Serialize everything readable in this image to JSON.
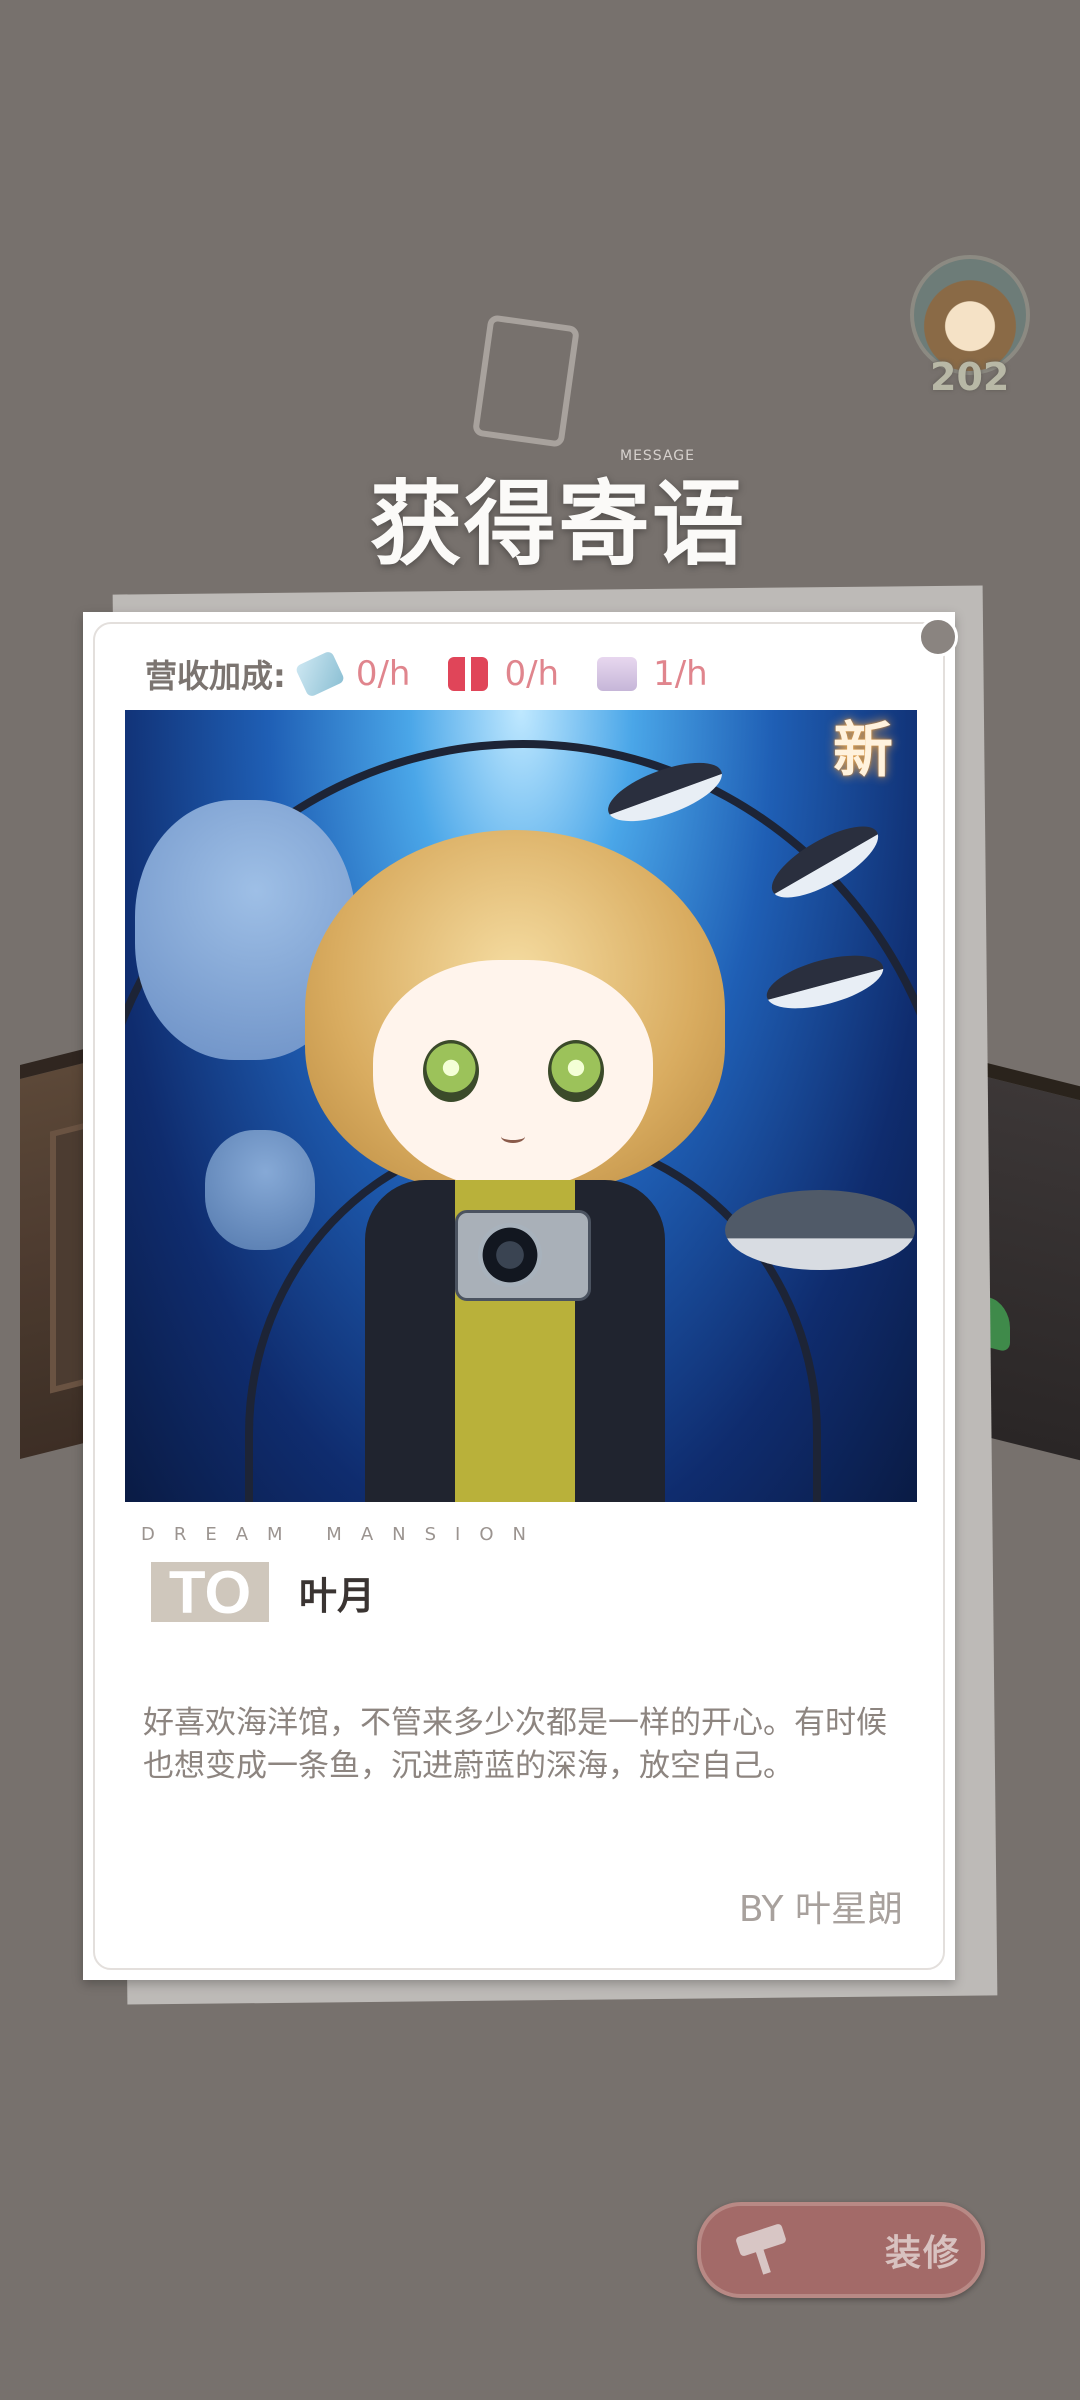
{
  "popup": {
    "title": "获得寄语",
    "title_sub": "MESSAGE",
    "new_tag": "新"
  },
  "player": {
    "level": "202"
  },
  "card": {
    "stats_label": "营收加成:",
    "stats": [
      {
        "icon": "money-icon",
        "value": "0/h"
      },
      {
        "icon": "gift-icon",
        "value": "0/h"
      },
      {
        "icon": "guests-icon",
        "value": "1/h"
      }
    ],
    "brand": "DREAM MANSION",
    "to_label": "TO",
    "to_name": "叶月",
    "message": "好喜欢海洋馆，不管来多少次都是一样的开心。有时候也想变成一条鱼，沉进蔚蓝的深海，放空自己。",
    "signature": "BY 叶星朗"
  },
  "buttons": {
    "renovate": "装修"
  },
  "colors": {
    "background": "#77716d",
    "stat_value": "#e0858d",
    "button": "#a36a68"
  }
}
